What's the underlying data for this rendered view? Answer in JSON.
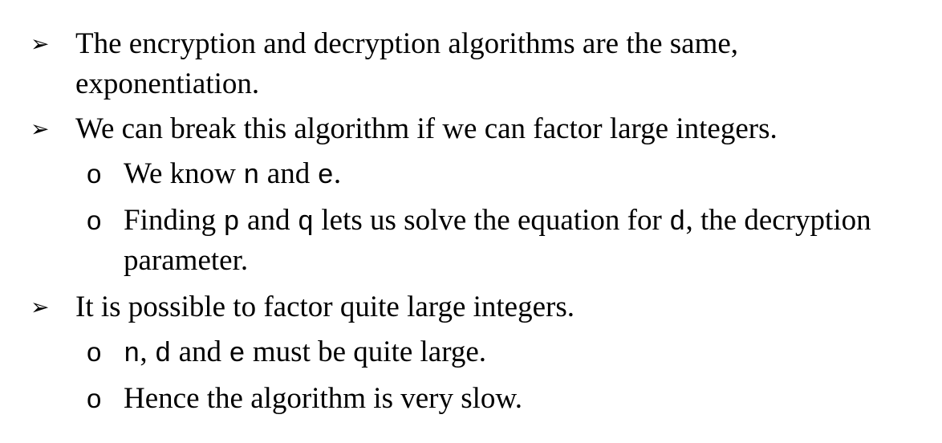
{
  "bullets": [
    {
      "marker": "➢",
      "lines": [
        "The encryption and decryption algorithms are the same,",
        "exponentiation."
      ]
    },
    {
      "marker": "➢",
      "lines": [
        "We can break this algorithm if we can factor large integers."
      ]
    },
    {
      "marker": "o",
      "parts": {
        "t1": "We know ",
        "c1": "n",
        "t2": " and ",
        "c2": "e",
        "t3": "."
      }
    },
    {
      "marker": "o",
      "parts": {
        "t1": "Finding ",
        "c1": "p",
        "t2": " and ",
        "c2": "q",
        "t3": " lets us solve the equation for ",
        "c3": "d",
        "t4": ", the decryption",
        "line2": "parameter."
      }
    },
    {
      "marker": "➢",
      "lines": [
        "It is possible to factor quite large integers."
      ]
    },
    {
      "marker": "o",
      "parts": {
        "c1": "n",
        "t1": ", ",
        "c2": "d",
        "t2": " and ",
        "c3": "e",
        "t3": " must be quite large."
      }
    },
    {
      "marker": "o",
      "lines": [
        "Hence the algorithm is very slow."
      ]
    }
  ]
}
